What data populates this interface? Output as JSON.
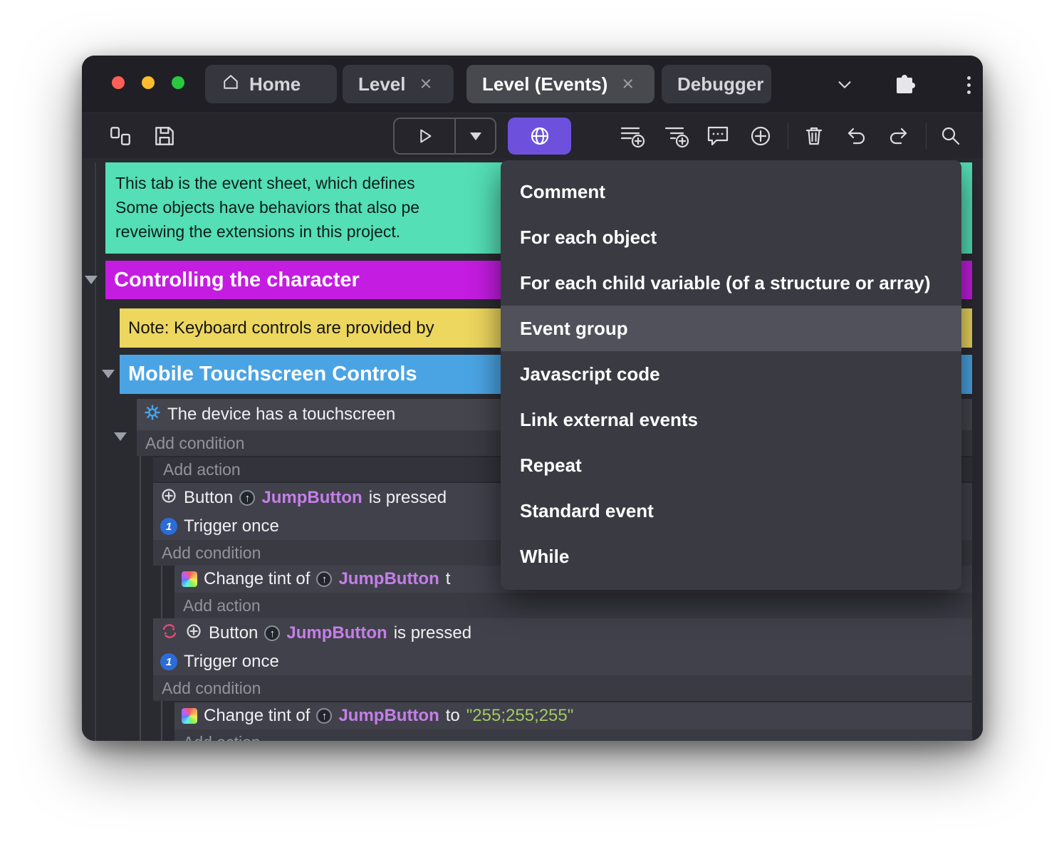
{
  "colors": {
    "accent_purple": "#6d51dd",
    "comment_teal": "#54dfb6",
    "group_magenta": "#c41ce0",
    "note_yellow": "#edd75e",
    "group_blue": "#4aa4e4",
    "object_purple": "#c47fe8",
    "value_green": "#a2c964",
    "trigger_blue": "#2c6cd8",
    "inverted_red": "#e84a78"
  },
  "titlebar": {
    "tabs": [
      {
        "label": "Home"
      },
      {
        "label": "Level",
        "close": "×"
      },
      {
        "label": "Level (Events)",
        "close": "×"
      },
      {
        "label": "Debugger"
      }
    ]
  },
  "sheet": {
    "comment": {
      "line1": "This tab is the event sheet, which defines",
      "line2": "Some objects have behaviors that also pe",
      "line3": "reveiwing the extensions in this project."
    },
    "group_controlling": {
      "label": "Controlling the character"
    },
    "note": {
      "label": "Note: Keyboard controls are provided by"
    },
    "group_mobile": {
      "label": "Mobile Touchscreen Controls"
    },
    "touch_condition": {
      "label": "The device has a touchscreen"
    },
    "labels": {
      "add_condition": "Add condition",
      "add_action": "Add action",
      "trigger_once": "Trigger once"
    },
    "button_event": {
      "prefix": "Button",
      "object": "JumpButton",
      "suffix": "is pressed"
    },
    "tint_action_1": {
      "prefix": "Change tint of",
      "object": "JumpButton",
      "suffix": "t"
    },
    "tint_action_2": {
      "prefix": "Change tint of",
      "object": "JumpButton",
      "to": "to",
      "value": "\"255;255;255\""
    },
    "glyphs": {
      "object_icon": "↑",
      "trigger_once_icon": "1"
    }
  },
  "context_menu": {
    "highlighted_index": 3,
    "items": [
      {
        "label": "Comment"
      },
      {
        "label": "For each object"
      },
      {
        "label": "For each child variable (of a structure or array)"
      },
      {
        "label": "Event group"
      },
      {
        "label": "Javascript code"
      },
      {
        "label": "Link external events"
      },
      {
        "label": "Repeat"
      },
      {
        "label": "Standard event"
      },
      {
        "label": "While"
      }
    ]
  }
}
